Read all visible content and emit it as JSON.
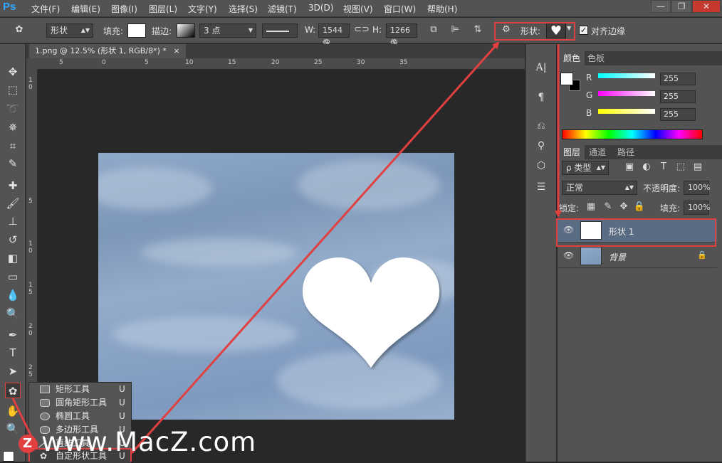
{
  "app": {
    "logo": "Ps",
    "win_min": "—",
    "win_restore": "❐",
    "win_close": "✕"
  },
  "menu": [
    "文件(F)",
    "编辑(E)",
    "图像(I)",
    "图层(L)",
    "文字(Y)",
    "选择(S)",
    "滤镜(T)",
    "3D(D)",
    "视图(V)",
    "窗口(W)",
    "帮助(H)"
  ],
  "options": {
    "mode": "形状",
    "fill_label": "填充:",
    "stroke_label": "描边:",
    "stroke_width": "3 点",
    "w_label": "W:",
    "w_value": "1544 像",
    "h_label": "H:",
    "h_value": "1266 像",
    "shape_label": "形状:",
    "align_edges": "对齐边缘",
    "align_checked": "✓"
  },
  "document": {
    "tab_title": "1.png @ 12.5% (形状 1, RGB/8*) *",
    "tab_close": "×",
    "ruler_top": [
      "5",
      "0",
      "5",
      "10",
      "15",
      "20",
      "25",
      "30",
      "35"
    ],
    "ruler_left": [
      "1 0",
      "5",
      "1 0",
      "1 5",
      "2 0",
      "2 5"
    ]
  },
  "color_panel": {
    "tabs": [
      "颜色",
      "色板"
    ],
    "r_label": "R",
    "g_label": "G",
    "b_label": "B",
    "r": "255",
    "g": "255",
    "b": "255"
  },
  "layers_panel": {
    "tabs": [
      "图层",
      "通道",
      "路径"
    ],
    "filter": "ρ 类型",
    "blend_mode": "正常",
    "opacity_label": "不透明度:",
    "opacity": "100%",
    "lock_label": "锁定:",
    "fill_label": "填充:",
    "fill": "100%",
    "layers": [
      {
        "name": "形状 1",
        "selected": true
      },
      {
        "name": "背景",
        "locked": true
      }
    ]
  },
  "flyout": {
    "items": [
      {
        "name": "矩形工具",
        "key": "U"
      },
      {
        "name": "圆角矩形工具",
        "key": "U"
      },
      {
        "name": "椭圆工具",
        "key": "U"
      },
      {
        "name": "多边形工具",
        "key": "U"
      },
      {
        "name": "直线工具",
        "key": "U"
      },
      {
        "name": "自定形状工具",
        "key": "U"
      }
    ]
  },
  "watermark": {
    "badge": "Z",
    "text": "www.MacZ.com"
  },
  "colors": {
    "accent_red": "#e04040",
    "selection": "#5a6b84",
    "panel_bg": "#535353"
  }
}
